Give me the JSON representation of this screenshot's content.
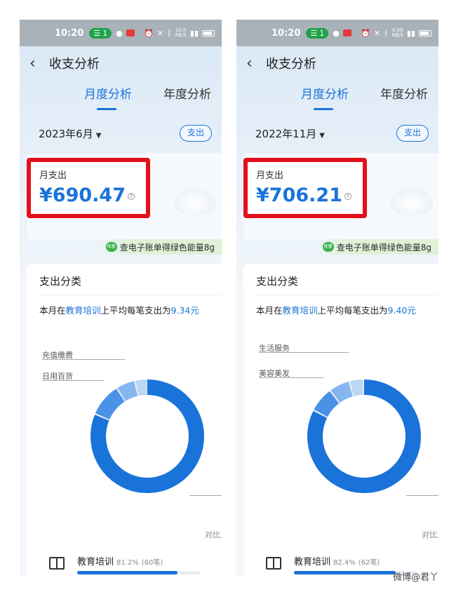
{
  "watermark": "微博@君丫",
  "colors": {
    "accent": "#1a73d9",
    "highlight_border": "#e4101a",
    "promo_green": "#37b24d"
  },
  "phones": [
    {
      "status": {
        "time": "10:20",
        "wifi_count": "1",
        "net_speed_top": "10.0",
        "net_speed_bottom": "KB/S"
      },
      "nav": {
        "back": "‹",
        "title": "收支分析"
      },
      "tabs": {
        "active": "月度分析",
        "inactive": "年度分析"
      },
      "period": {
        "label": "2023年6月",
        "type_chip": "支出"
      },
      "summary": {
        "label": "月支出",
        "amount": "¥690.47"
      },
      "promo": {
        "badge": "能量",
        "text": "查电子账单得绿色能量8g"
      },
      "category": {
        "title": "支出分类",
        "avg_prefix": "本月在",
        "avg_category": "教育培训",
        "avg_mid": "上平均每笔支出为",
        "avg_value": "9.34元",
        "labels": [
          "充值缴费",
          "日用百货"
        ],
        "compare": "对比上",
        "top_item": {
          "name": "教育培训",
          "pct": "81.2%",
          "count": "(60笔)",
          "fraction": 0.812
        }
      }
    },
    {
      "status": {
        "time": "10:20",
        "wifi_count": "1",
        "net_speed_top": "0.00",
        "net_speed_bottom": "KB/S"
      },
      "nav": {
        "back": "‹",
        "title": "收支分析"
      },
      "tabs": {
        "active": "月度分析",
        "inactive": "年度分析"
      },
      "period": {
        "label": "2022年11月",
        "type_chip": "支出"
      },
      "summary": {
        "label": "月支出",
        "amount": "¥706.21"
      },
      "promo": {
        "badge": "能量",
        "text": "查电子账单得绿色能量8g"
      },
      "category": {
        "title": "支出分类",
        "avg_prefix": "本月在",
        "avg_category": "教育培训",
        "avg_mid": "上平均每笔支出为",
        "avg_value": "9.40元",
        "labels": [
          "生活服务",
          "美容美发"
        ],
        "compare": "对比上",
        "top_item": {
          "name": "教育培训",
          "pct": "82.4%",
          "count": "(62笔)",
          "fraction": 0.824
        }
      }
    }
  ]
}
